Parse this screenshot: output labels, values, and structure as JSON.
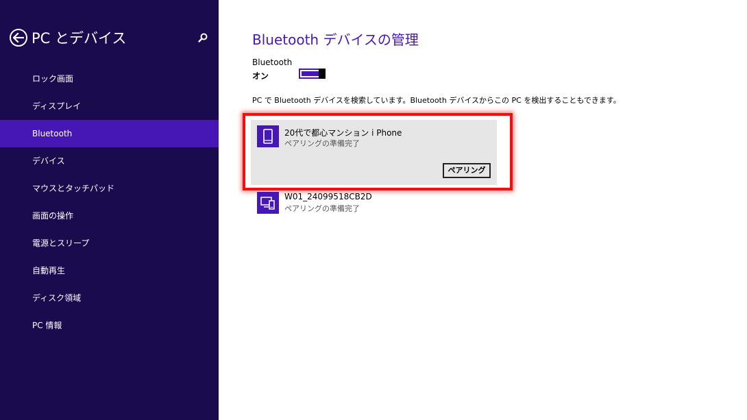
{
  "sidebar": {
    "title": "PC とデバイス",
    "back_icon": "back-arrow-circle-icon",
    "search_icon": "search-icon",
    "items": [
      {
        "label": "ロック画面",
        "selected": false
      },
      {
        "label": "ディスプレイ",
        "selected": false
      },
      {
        "label": "Bluetooth",
        "selected": true
      },
      {
        "label": "デバイス",
        "selected": false
      },
      {
        "label": "マウスとタッチパッド",
        "selected": false
      },
      {
        "label": "画面の操作",
        "selected": false
      },
      {
        "label": "電源とスリープ",
        "selected": false
      },
      {
        "label": "自動再生",
        "selected": false
      },
      {
        "label": "ディスク領域",
        "selected": false
      },
      {
        "label": "PC 情報",
        "selected": false
      }
    ]
  },
  "main": {
    "title": "Bluetooth デバイスの管理",
    "bluetooth_label": "Bluetooth",
    "bluetooth_state": "オン",
    "bluetooth_on": true,
    "description": "PC で Bluetooth デバイスを検索しています。Bluetooth デバイスからこの PC を検出することもできます。",
    "devices": [
      {
        "name": "20代で都心マンション i Phone",
        "status": "ペアリングの準備完了",
        "icon": "phone-icon",
        "action_label": "ペアリング",
        "highlighted": true
      },
      {
        "name": "W01_24099518CB2D",
        "status": "ペアリングの準備完了",
        "icon": "computer-phone-icon"
      }
    ]
  },
  "colors": {
    "sidebar_bg": "#1a0a4e",
    "accent": "#4617b4",
    "highlight_frame": "#ee1111",
    "card_bg": "#e6e6e6"
  }
}
